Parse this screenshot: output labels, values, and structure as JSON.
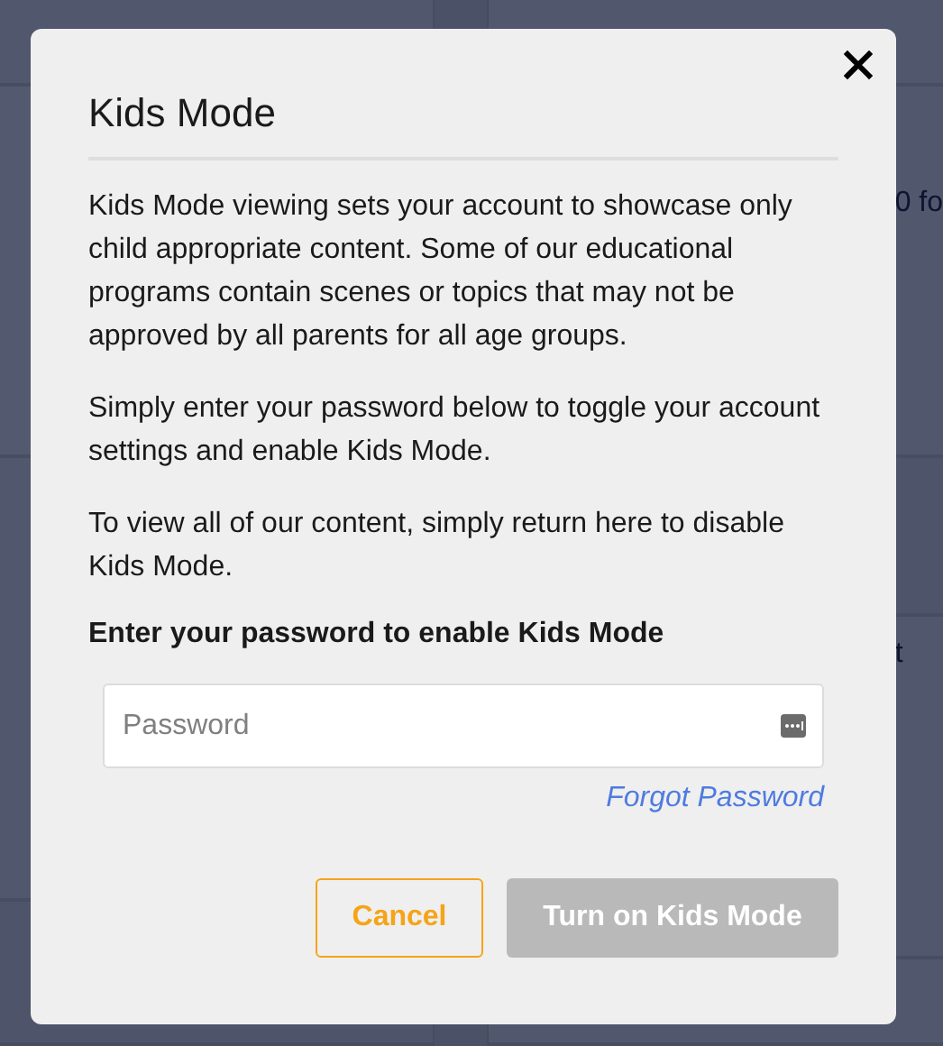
{
  "background": {
    "texts": [
      "0 fo",
      "t"
    ]
  },
  "dialog": {
    "title": "Kids Mode",
    "paragraphs": [
      "Kids Mode viewing sets your account to showcase only child appropriate content. Some of our educational programs contain scenes or topics that may not be approved by all parents for all age groups.",
      "Simply enter your password below to toggle your account settings and enable Kids Mode.",
      "To view all of our content, simply return here to disable Kids Mode."
    ],
    "prompt": "Enter your password to enable Kids Mode",
    "password_field": {
      "placeholder": "Password"
    },
    "forgot_link": "Forgot Password",
    "buttons": [
      {
        "label": "Cancel",
        "kind": "secondary",
        "disabled": false
      },
      {
        "label": "Turn on Kids Mode",
        "kind": "primary",
        "disabled": true
      }
    ]
  }
}
